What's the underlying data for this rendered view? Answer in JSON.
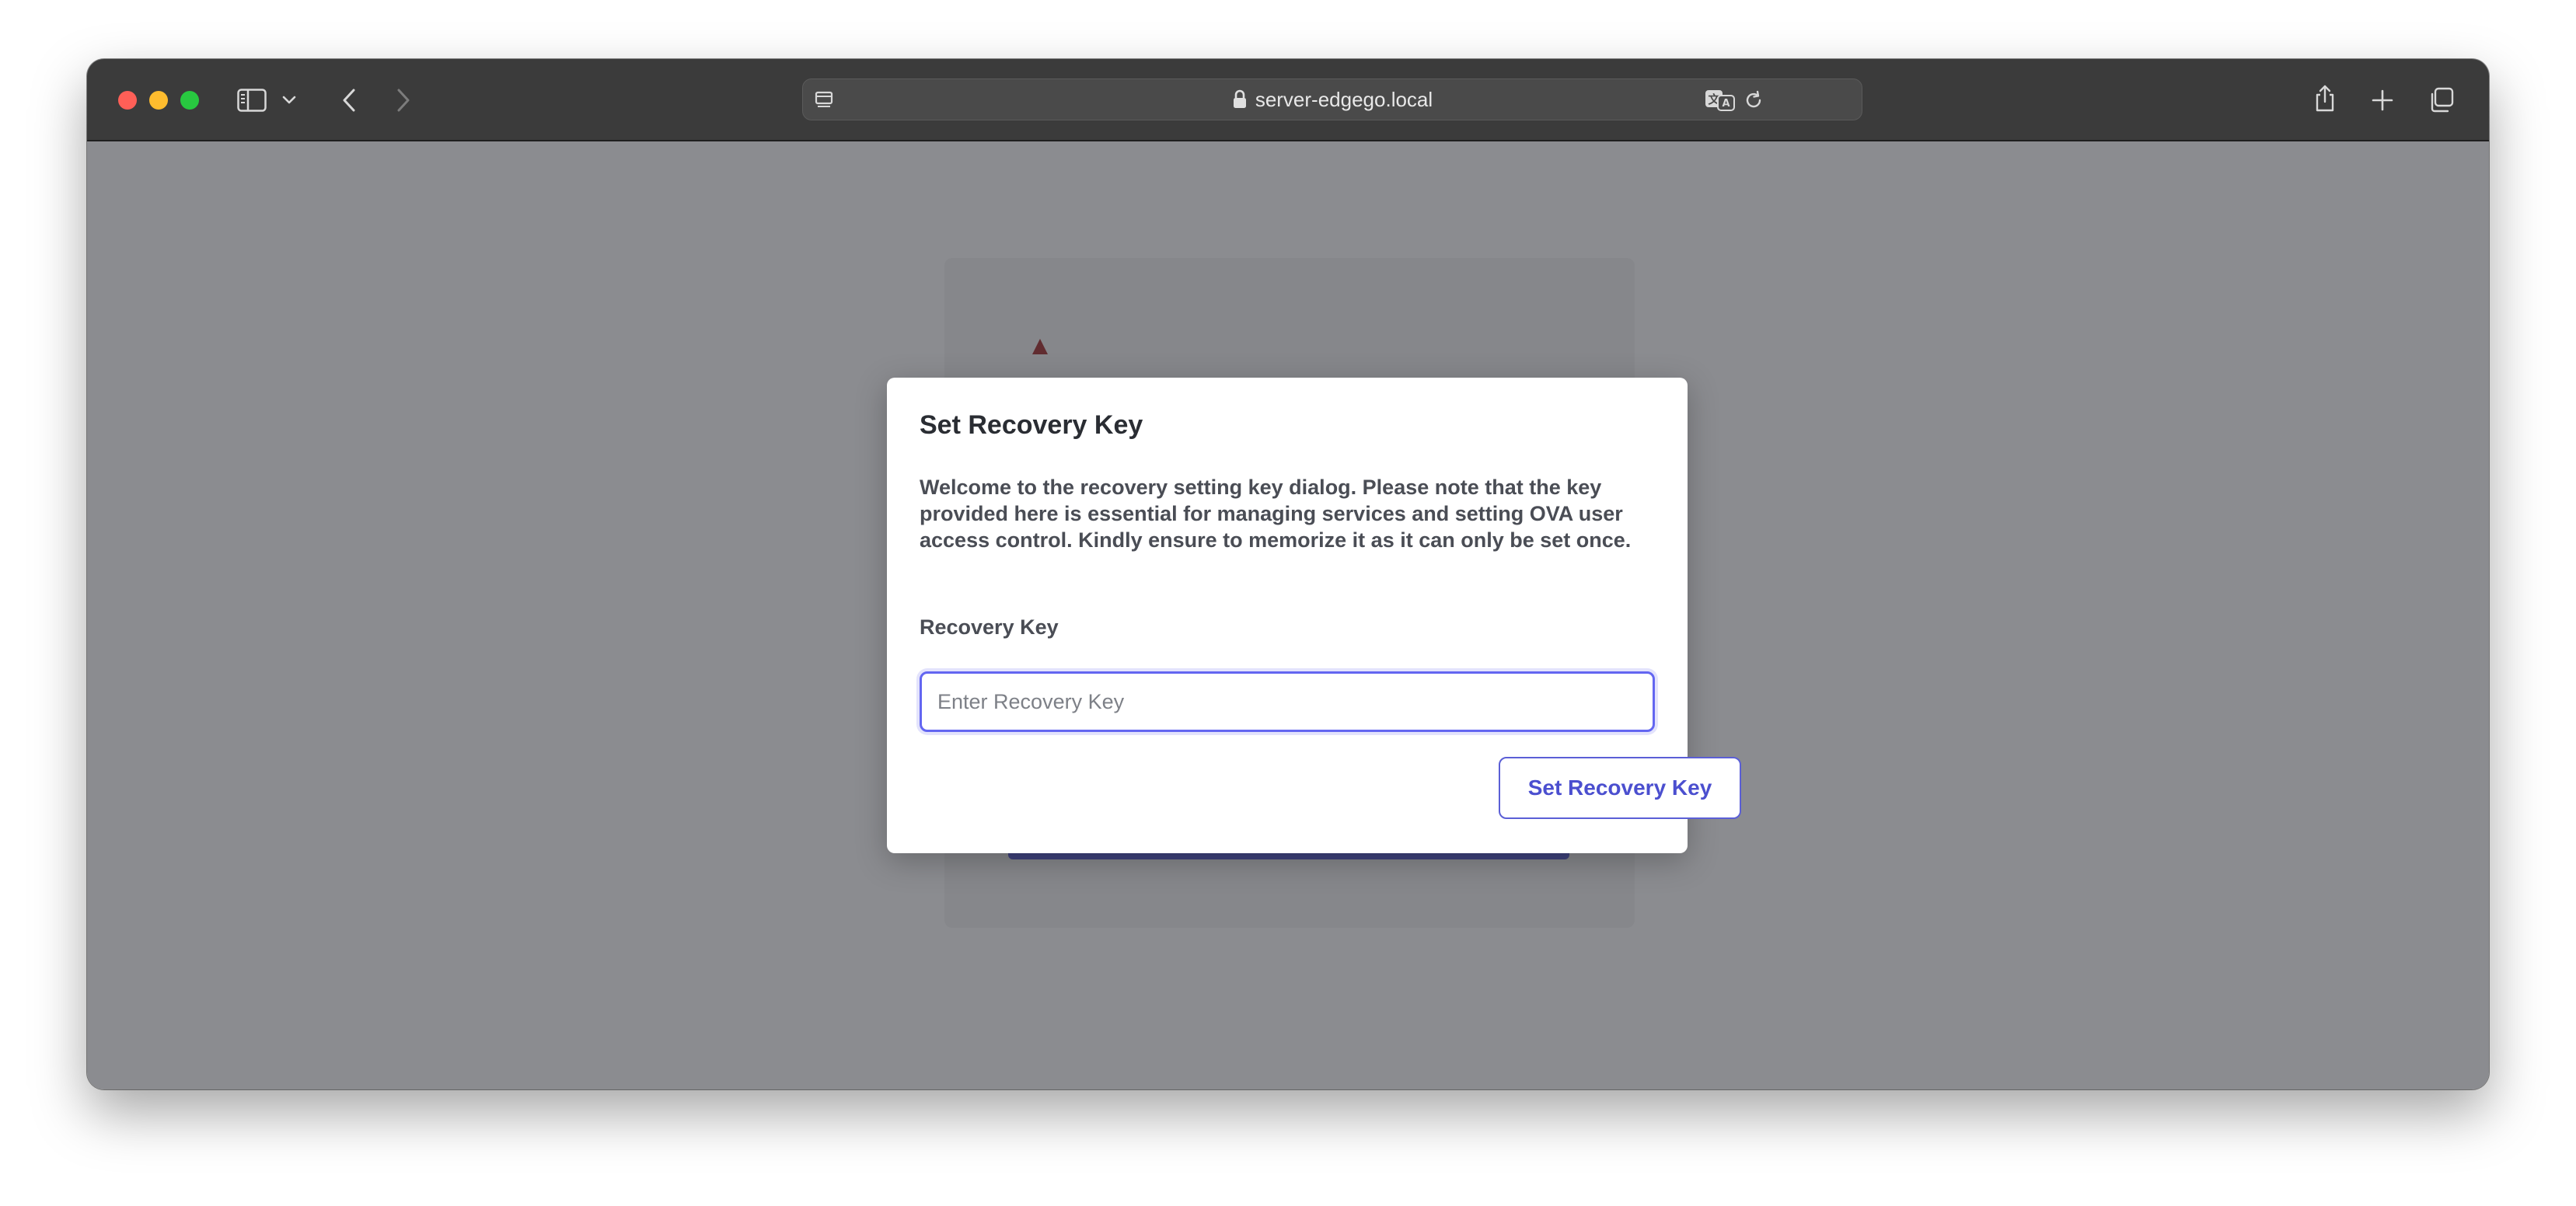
{
  "browser": {
    "url": "server-edgego.local",
    "icons": {
      "close": "close-traffic-light",
      "minimize": "minimize-traffic-light",
      "maximize": "maximize-traffic-light",
      "sidebar": "sidebar-icon",
      "sidebar_menu": "chevron-down-icon",
      "back": "chevron-left-icon",
      "forward": "chevron-right-icon",
      "page_menu": "page-menu-icon",
      "lock": "lock-icon",
      "translate": "translate-icon",
      "reload": "reload-icon",
      "share": "share-icon",
      "new_tab": "plus-icon",
      "tab_overview": "tab-overview-icon"
    }
  },
  "dialog": {
    "title": "Set Recovery Key",
    "description": "Welcome to the recovery setting key dialog. Please note that the key provided here is essential for managing services and setting OVA user access control. Kindly ensure to memorize it as it can only be set once.",
    "field_label": "Recovery Key",
    "field_placeholder": "Enter Recovery Key",
    "field_value": "",
    "submit_label": "Set Recovery Key"
  },
  "colors": {
    "accent": "#4b4fcf",
    "input_focus": "#6366f1",
    "overlay": "#373940",
    "titlebar": "#3b3b3b"
  }
}
